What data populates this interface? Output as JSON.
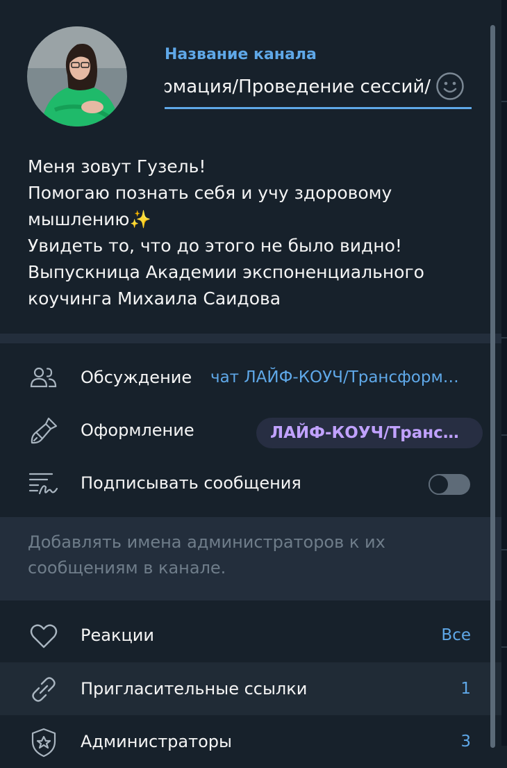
{
  "channel": {
    "name_label": "Название канала",
    "name_value": "ЛАЙФ-КОУЧ/Трансформация/Проведение сессий/"
  },
  "description_lines": [
    "Меня зовут Гузель!",
    "Помогаю познать себя и учу здоровому мышлению✨",
    "Увидеть то, что до этого не было видно!",
    "Выпускница Академии экспоненциального коучинга Михаила Саидова"
  ],
  "settings": {
    "discussion": {
      "label": "Обсуждение",
      "value": "чат ЛАЙФ-КОУЧ/Трансформ…"
    },
    "appearance": {
      "label": "Оформление",
      "value": "ЛАЙФ-КОУЧ/Трансф…"
    },
    "sign_messages": {
      "label": "Подписывать сообщения",
      "enabled": false
    }
  },
  "hint": "Добавлять имена администраторов к их сообщениям в канале.",
  "management": {
    "reactions": {
      "label": "Реакции",
      "value": "Все"
    },
    "invite_links": {
      "label": "Пригласительные ссылки",
      "value": "1"
    },
    "admins": {
      "label": "Администраторы",
      "value": "3"
    }
  },
  "colors": {
    "background": "#17212b",
    "accent": "#5fa8e8",
    "pill_text": "#c1a2ff",
    "secondary_text": "#6f7d8a"
  },
  "icons": [
    "people-icon",
    "brush-icon",
    "signature-icon",
    "heart-icon",
    "link-icon",
    "shield-star-icon",
    "emoji-icon"
  ]
}
